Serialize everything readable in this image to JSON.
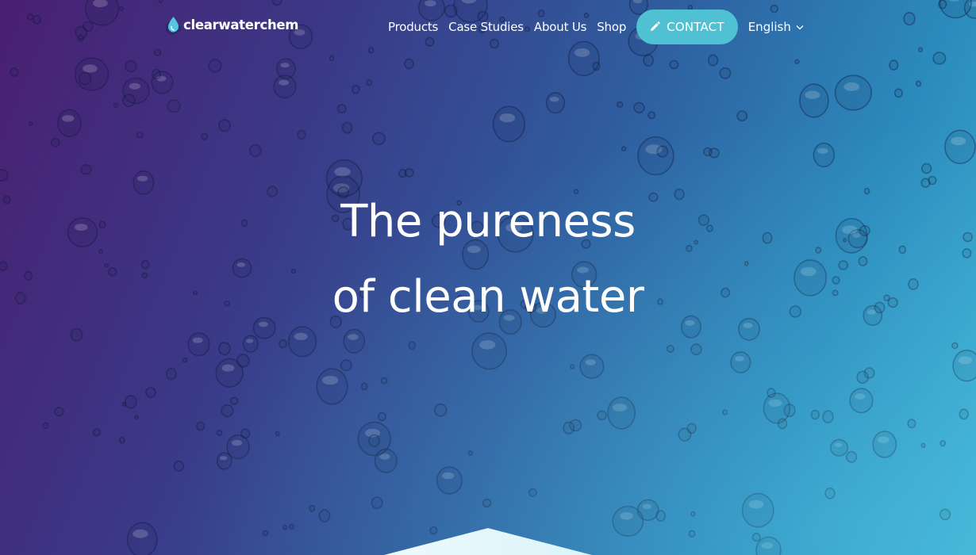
{
  "brand": {
    "name": "clearwaterchem",
    "logo_icon": "water-drop-icon",
    "accent_color": "#4fc1d3"
  },
  "nav": {
    "items": [
      {
        "label": "Products"
      },
      {
        "label": "Case Studies"
      },
      {
        "label": "About Us"
      },
      {
        "label": "Shop"
      }
    ],
    "contact_label": "CONTACT",
    "contact_icon": "pencil-icon",
    "language": "English",
    "language_icon": "chevron-down-icon"
  },
  "hero": {
    "line1": "The pureness",
    "line2": "of clean water",
    "background": "water-droplets-gradient"
  }
}
